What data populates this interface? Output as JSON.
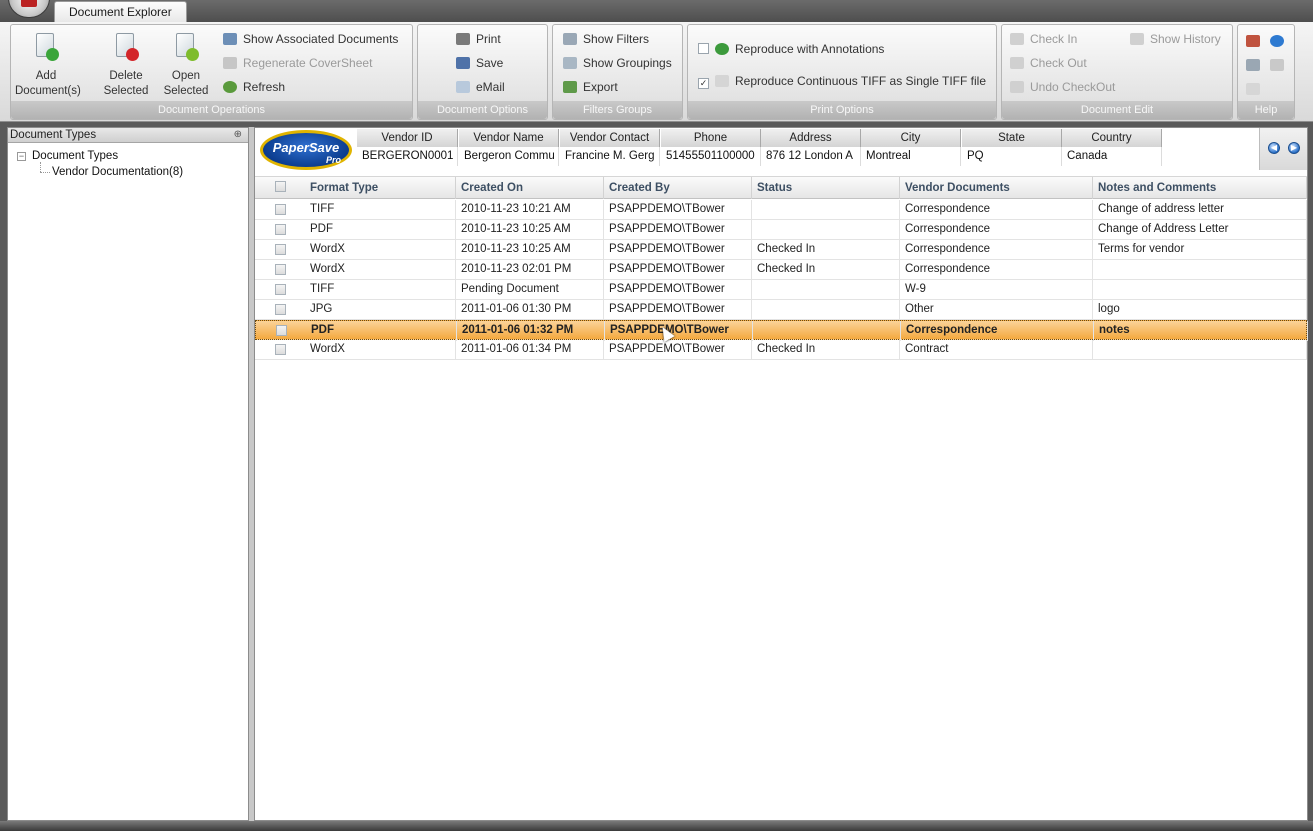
{
  "window": {
    "tab": "Document Explorer"
  },
  "ribbon": {
    "document_operations": {
      "caption": "Document Operations",
      "add": "Add\nDocument(s)",
      "add_line1": "Add",
      "add_line2": "Document(s)",
      "delete_line1": "Delete",
      "delete_line2": "Selected",
      "open_line1": "Open",
      "open_line2": "Selected",
      "show_associated": "Show Associated Documents",
      "regenerate": "Regenerate CoverSheet",
      "refresh": "Refresh"
    },
    "document_options": {
      "caption": "Document Options",
      "print": "Print",
      "save": "Save",
      "email": "eMail"
    },
    "filters_groups": {
      "caption": "Filters  Groups",
      "show_filters": "Show Filters",
      "show_groupings": "Show Groupings",
      "export": "Export"
    },
    "print_options": {
      "caption": "Print Options",
      "reproduce_annotations": "Reproduce with Annotations",
      "reproduce_annotations_checked": false,
      "reproduce_tiff": "Reproduce Continuous TIFF as Single TIFF file",
      "reproduce_tiff_checked": true
    },
    "document_edit": {
      "caption": "Document Edit",
      "check_in": "Check In",
      "show_history": "Show History",
      "check_out": "Check Out",
      "undo_checkout": "Undo CheckOut"
    },
    "help": {
      "caption": "Help"
    }
  },
  "left_panel": {
    "header": "Document Types",
    "pin": "⊕",
    "tree_root": "Document Types",
    "tree_child": "Vendor Documentation(8)"
  },
  "vendor": {
    "logo": "PaperSave",
    "logo_sub": "Pro",
    "headers": [
      "Vendor ID",
      "Vendor Name",
      "Vendor Contact",
      "Phone",
      "Address",
      "City",
      "State",
      "Country"
    ],
    "values": [
      "BERGERON0001",
      "Bergeron Commu",
      "Francine M. Gerg",
      "51455501100000",
      "876 12 London A",
      "Montreal",
      "PQ",
      "Canada"
    ]
  },
  "grid": {
    "columns": [
      "Format Type",
      "Created On",
      "Created By",
      "Status",
      "Vendor Documents",
      "Notes and Comments"
    ],
    "rows": [
      [
        "TIFF",
        "2010-11-23 10:21 AM",
        "PSAPPDEMO\\TBower",
        "",
        "Correspondence",
        "Change of address letter"
      ],
      [
        "PDF",
        "2010-11-23 10:25 AM",
        "PSAPPDEMO\\TBower",
        "",
        "Correspondence",
        "Change of Address Letter"
      ],
      [
        "WordX",
        "2010-11-23 10:25 AM",
        "PSAPPDEMO\\TBower",
        "Checked In",
        "Correspondence",
        "Terms for vendor"
      ],
      [
        "WordX",
        "2010-11-23 02:01 PM",
        "PSAPPDEMO\\TBower",
        "Checked In",
        "Correspondence",
        ""
      ],
      [
        "TIFF",
        "Pending Document",
        "PSAPPDEMO\\TBower",
        "",
        "W-9",
        ""
      ],
      [
        "JPG",
        "2011-01-06 01:30 PM",
        "PSAPPDEMO\\TBower",
        "",
        "Other",
        "logo"
      ],
      [
        "PDF",
        "2011-01-06 01:32 PM",
        "PSAPPDEMO\\TBower",
        "",
        "Correspondence",
        "notes"
      ],
      [
        "WordX",
        "2011-01-06 01:34 PM",
        "PSAPPDEMO\\TBower",
        "Checked In",
        "Contract",
        ""
      ]
    ],
    "selected_row": 6
  },
  "colors": {
    "selected_row": "#f4a93f",
    "header_text": "#3d4f63",
    "ribbon_caption": "#b2b2b2"
  }
}
